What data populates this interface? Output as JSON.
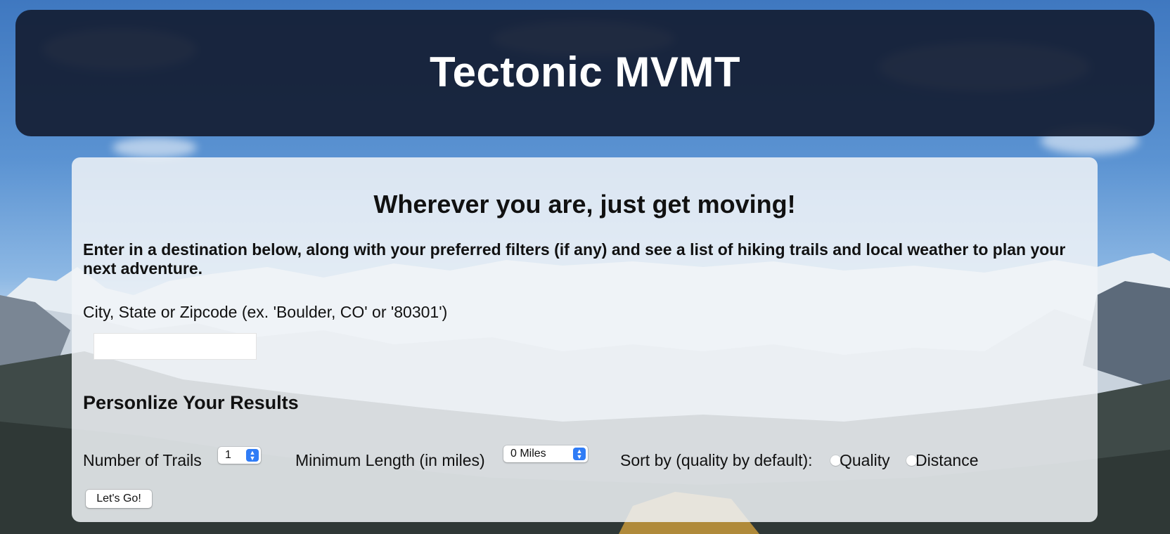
{
  "header": {
    "title": "Tectonic MVMT"
  },
  "main": {
    "tagline": "Wherever you are, just get moving!",
    "intro": "Enter in a destination below, along with your preferred filters (if any) and see a list of hiking trails and local weather to plan your next adventure.",
    "location": {
      "label": "City, State or Zipcode (ex. 'Boulder, CO' or '80301')",
      "value": "",
      "placeholder": ""
    },
    "personalize_heading": "Personlize Your Results",
    "filters": {
      "num_trails": {
        "label": "Number of Trails",
        "selected": "1"
      },
      "min_length": {
        "label": "Minimum Length (in miles)",
        "selected": "0 Miles"
      },
      "sort": {
        "label": "Sort by (quality by default):",
        "options": [
          "Quality",
          "Distance"
        ]
      }
    },
    "submit_label": "Let's Go!"
  },
  "colors": {
    "header_bg": "#141e34",
    "card_bg": "#f0f3f7",
    "select_arrow_accent": "#2f7cf6"
  }
}
